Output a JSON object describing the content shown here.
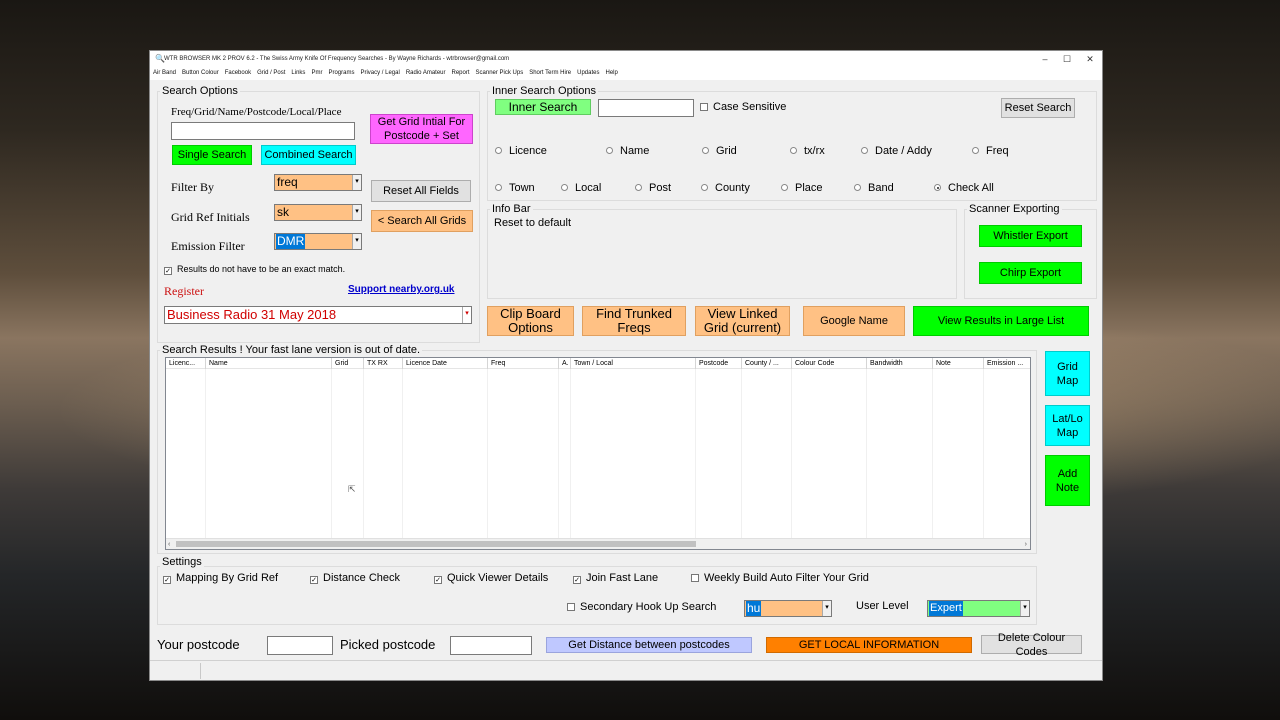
{
  "window": {
    "title": "WTR BROWSER MK 2 PROV 6.2 -  The Swiss Army Knife Of Frequency Searches - By Wayne Richards - wtrbrowser@gmail.com",
    "minimize": "–",
    "maximize": "☐",
    "close": "✕"
  },
  "menu": [
    "Air Band",
    "Button Colour",
    "Facebook",
    "Grid / Post",
    "Links",
    "Pmr",
    "Programs",
    "Privacy / Legal",
    "Radio Amateur",
    "Report",
    "Scanner Pick Ups",
    "Short Term Hire",
    "Updates",
    "Help"
  ],
  "search_options": {
    "title": "Search Options",
    "field_label": "Freq/Grid/Name/Postcode/Local/Place",
    "field_value": "",
    "grid_initial_button": "Get Grid Intial For Postcode + Set",
    "single_search": "Single Search",
    "combined_search": "Combined Search",
    "filter_by_label": "Filter By",
    "filter_by_value": "freq",
    "grid_ref_label": "Grid Ref Initials",
    "grid_ref_value": "sk",
    "emission_label": "Emission Filter",
    "emission_value": "DMR",
    "reset_all": "Reset All Fields",
    "search_all_grids": "< Search All Grids",
    "exact_match": "Results do not have to be an exact match.",
    "register": "Register",
    "support": "Support nearby.org.uk",
    "news_combo": "Business Radio 31 May 2018"
  },
  "inner_search": {
    "title": "Inner Search Options",
    "button": "Inner Search",
    "value": "",
    "case_sensitive": "Case Sensitive",
    "reset": "Reset Search",
    "radios_row1": [
      "Licence",
      "Name",
      "Grid",
      "tx/rx",
      "Date / Addy",
      "Freq"
    ],
    "radios_row2": [
      "Town",
      "Local",
      "Post",
      "County",
      "Place",
      "Band",
      "Check All"
    ]
  },
  "info_bar": {
    "title": "Info Bar",
    "text": "Reset to default"
  },
  "scanner": {
    "title": "Scanner Exporting",
    "whistler": "Whistler Export",
    "chirp": "Chirp Export"
  },
  "actions": {
    "clipboard": "Clip Board Options",
    "trunked": "Find Trunked Freqs",
    "linked": "View Linked Grid (current)",
    "google": "Google Name",
    "large_list": "View Results in Large List"
  },
  "results": {
    "title": "Search Results ! Your fast lane version is out of date.",
    "columns": [
      "Licenc...",
      "Name",
      "Grid",
      "TX RX",
      "Licence Date",
      "Freq",
      "A.",
      "Town / Local",
      "Postcode",
      "County / ...",
      "Colour Code",
      "Bandwidth",
      "Note",
      "Emission ..."
    ]
  },
  "side": {
    "grid_map": "Grid Map",
    "latlo_map": "Lat/Lo Map",
    "add_note": "Add Note"
  },
  "settings": {
    "title": "Settings",
    "mapping": "Mapping By Grid Ref",
    "distance": "Distance Check",
    "quick_viewer": "Quick Viewer Details",
    "fast_lane": "Join Fast Lane",
    "weekly": "Weekly Build Auto Filter Your Grid",
    "secondary": "Secondary Hook Up Search",
    "hookup_value": "hu",
    "user_level_label": "User Level",
    "user_level_value": "Expert"
  },
  "bottom": {
    "your_postcode": "Your postcode",
    "picked_postcode": "Picked postcode",
    "distance": "Get Distance between postcodes",
    "local_info": "GET LOCAL INFORMATION",
    "delete_colour": "Delete Colour Codes"
  }
}
